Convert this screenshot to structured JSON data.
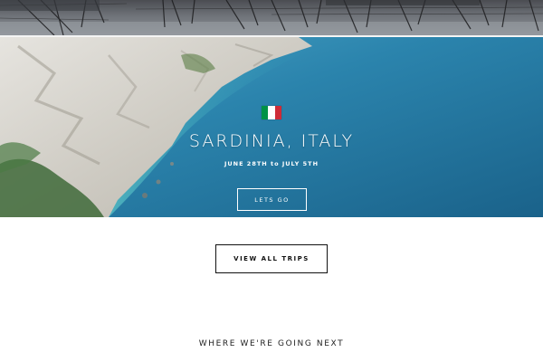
{
  "hero": {
    "title": "SARDINIA, ITALY",
    "dates": "JUNE 28TH to JULY 5TH",
    "cta_label": "LETS GO",
    "flag": {
      "name": "italy-flag",
      "colors": [
        "#009246",
        "#ffffff",
        "#ce2b37"
      ]
    }
  },
  "actions": {
    "view_all_label": "VIEW ALL TRIPS"
  },
  "sections": {
    "next_heading": "WHERE WE'RE GOING NEXT"
  },
  "colors": {
    "sea": "#1f74a0",
    "text_dark": "#111111",
    "background": "#ffffff"
  }
}
